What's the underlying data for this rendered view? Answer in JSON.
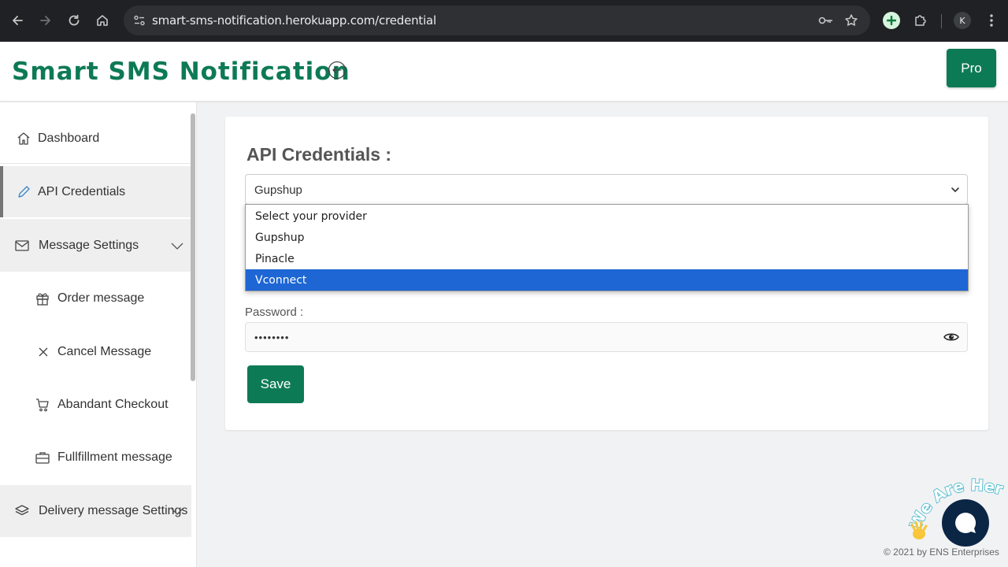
{
  "browser": {
    "url": "smart-sms-notification.herokuapp.com/credential",
    "profile_initial": "K"
  },
  "header": {
    "brand": "Smart SMS Notification",
    "pro_label": "Pro"
  },
  "sidebar": {
    "items": [
      {
        "label": "Dashboard",
        "icon": "home-icon"
      },
      {
        "label": "API Credentials",
        "icon": "pencil-icon"
      },
      {
        "label": "Message Settings",
        "icon": "envelope-icon"
      },
      {
        "label": "Order message",
        "icon": "gift-icon"
      },
      {
        "label": "Cancel Message",
        "icon": "x-icon"
      },
      {
        "label": "Abandant Checkout",
        "icon": "cart-icon"
      },
      {
        "label": "Fullfillment message",
        "icon": "briefcase-icon"
      },
      {
        "label": "Delivery message Settings",
        "icon": "layers-icon"
      }
    ]
  },
  "main": {
    "title": "API Credentials :",
    "provider_selected": "Gupshup",
    "provider_options": [
      "Select your provider",
      "Gupshup",
      "Pinacle",
      "Vconnect"
    ],
    "highlighted_option": "Vconnect",
    "password_label": "Password :",
    "password_value": "••••••••",
    "save_label": "Save"
  },
  "footer": {
    "copyright": "© 2021 by ENS Enterprises",
    "widget_text": "We Are Here!"
  },
  "colors": {
    "brand_green": "#0d7a56",
    "highlight_blue": "#1d66d4",
    "chat_navy": "#0b2545",
    "chrome_dark": "#202124"
  }
}
